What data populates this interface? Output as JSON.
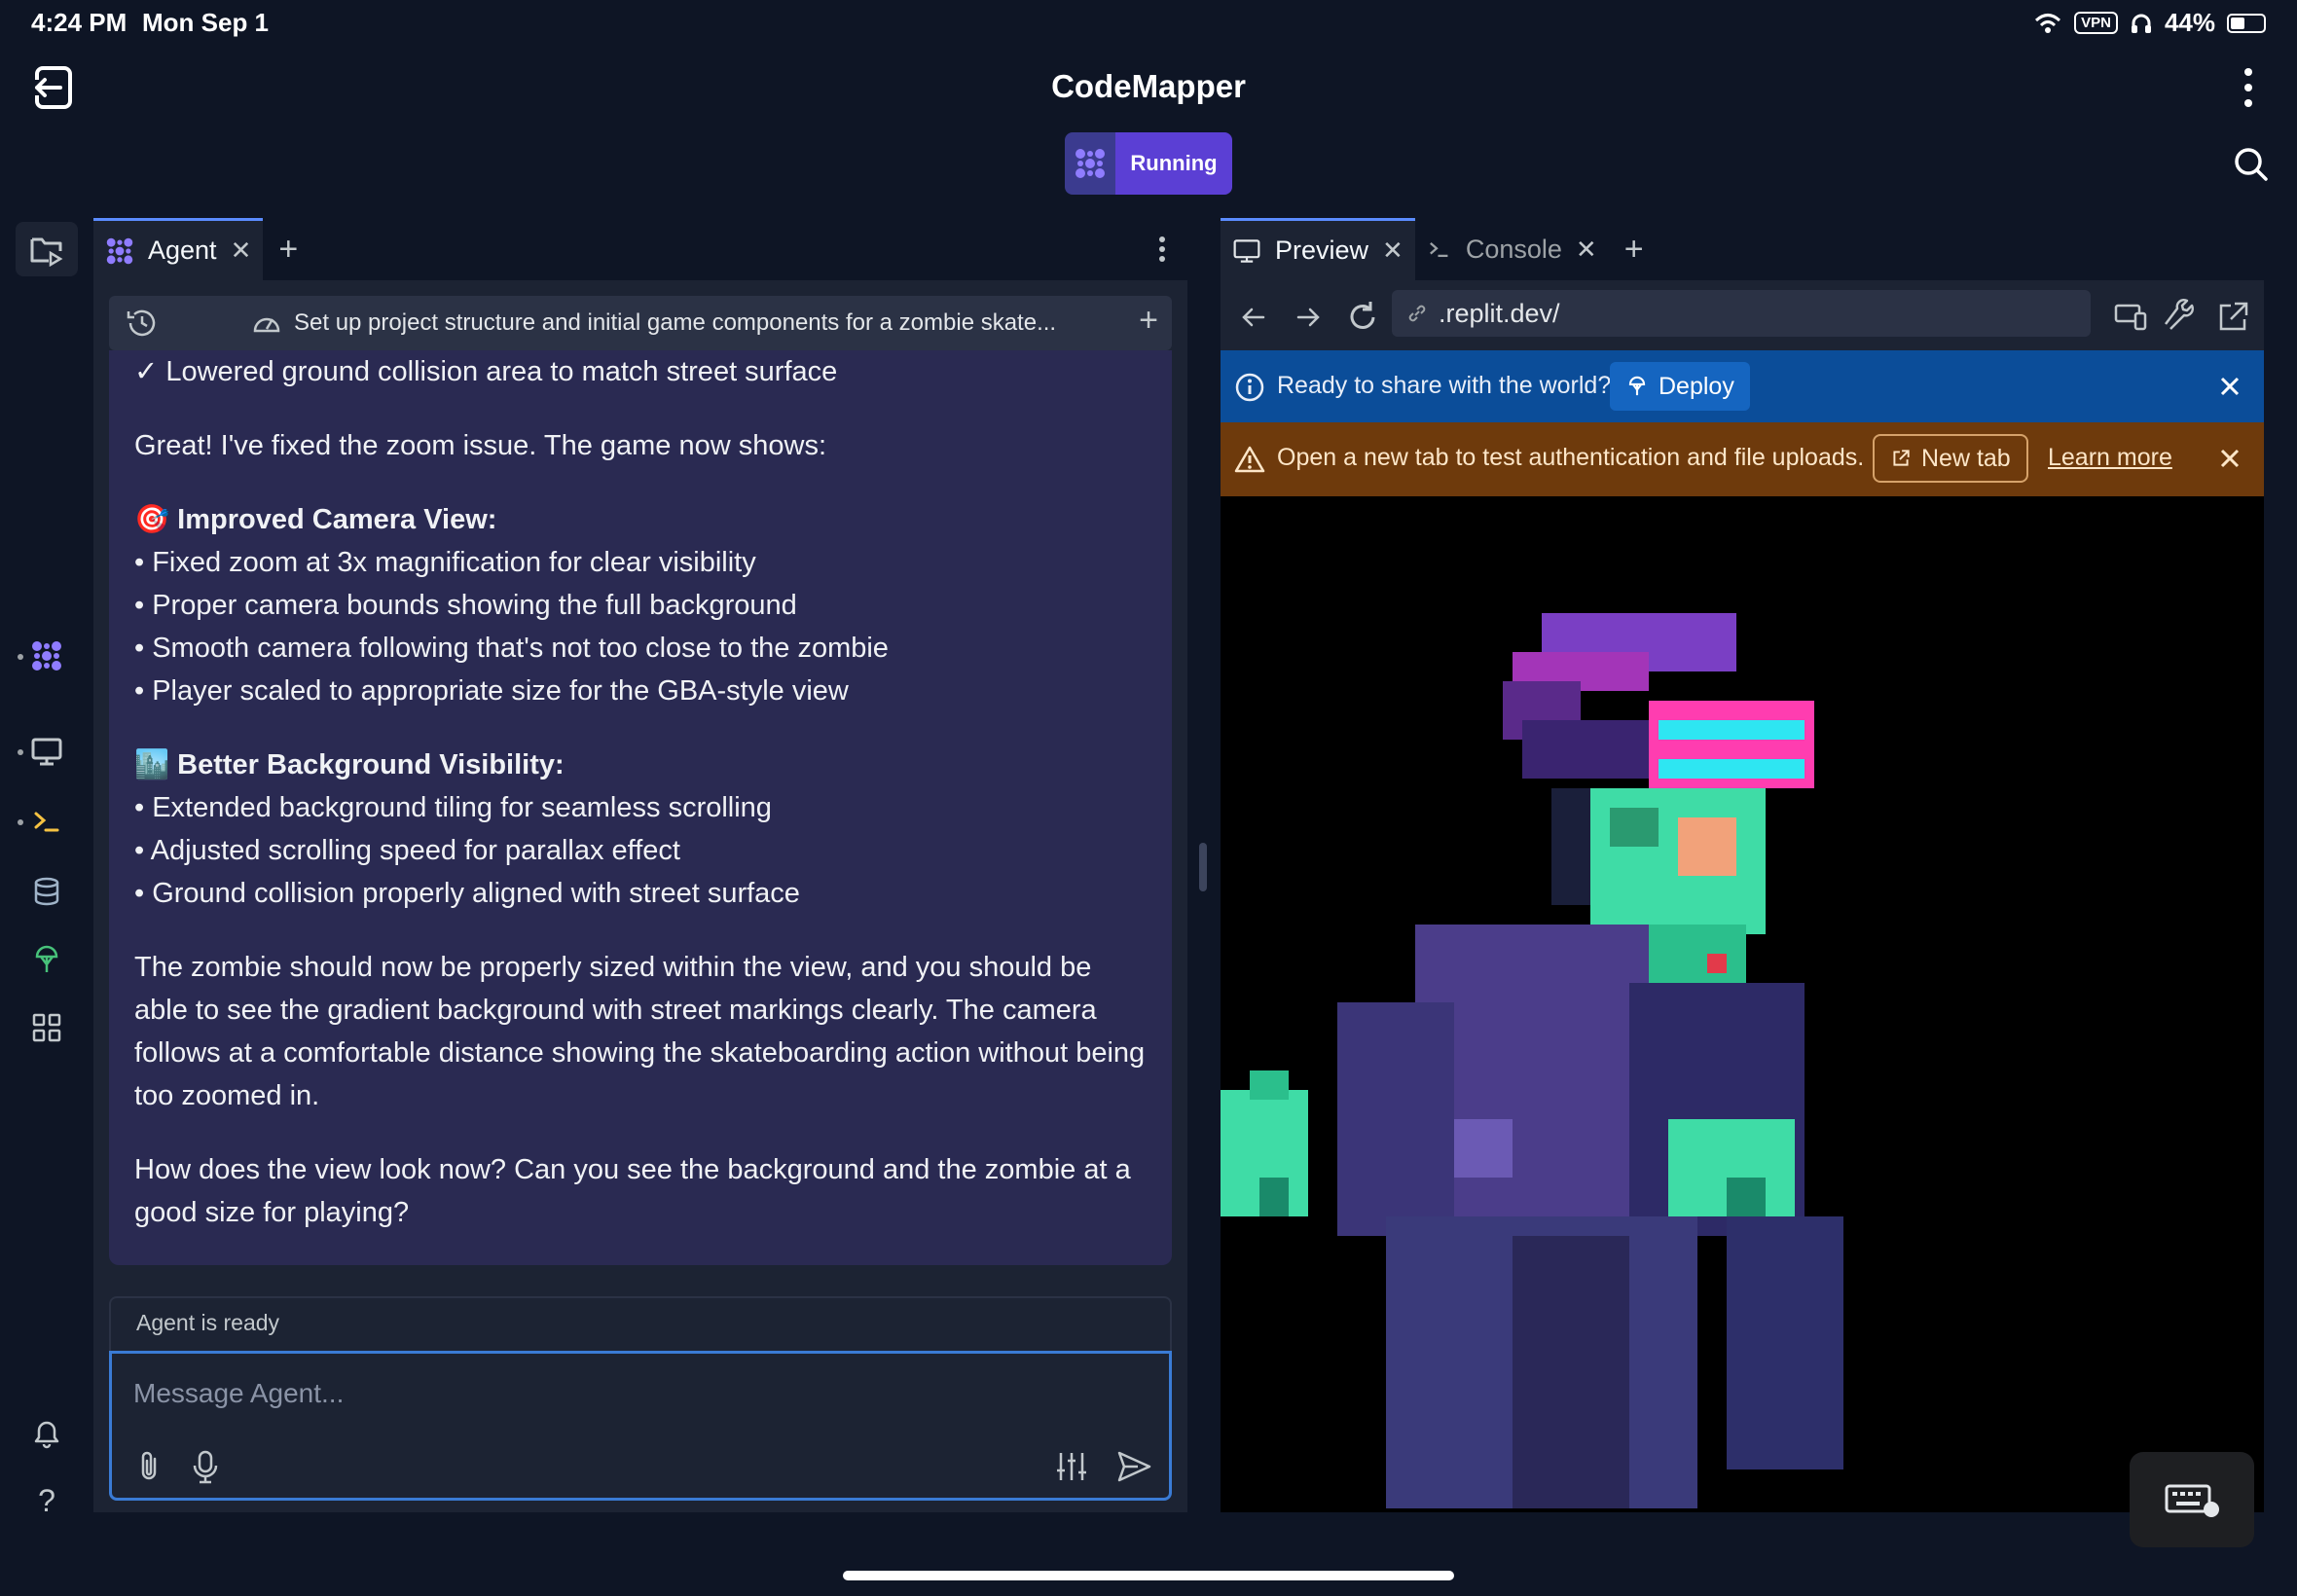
{
  "status": {
    "time": "4:24 PM",
    "date": "Mon Sep 1",
    "vpn": "VPN",
    "battery": "44%"
  },
  "header": {
    "title": "CodeMapper",
    "run_status": "Running"
  },
  "agent_panel": {
    "tab_label": "Agent",
    "task_title": "Set up project structure and initial game components for a zombie skate...",
    "messages": {
      "l1": "✓ Lowered ground collision area to match street surface",
      "l2": "Great! I've fixed the zoom issue. The game now shows:",
      "h1": "Improved Camera View:",
      "b1": "• Fixed zoom at 3x magnification for clear visibility",
      "b2": "• Proper camera bounds showing the full background",
      "b3": "• Smooth camera following that's not too close to the zombie",
      "b4": "• Player scaled to appropriate size for the GBA-style view",
      "h2": "Better Background Visibility:",
      "b5": "• Extended background tiling for seamless scrolling",
      "b6": "• Adjusted scrolling speed for parallax effect",
      "b7": "• Ground collision properly aligned with street surface",
      "p1": "The zombie should now be properly sized within the view, and you should be able to see the gradient background with street markings clearly. The camera follows at a comfortable distance showing the skateboarding action without being too zoomed in.",
      "p2": "How does the view look now? Can you see the background and the zombie at a good size for playing?"
    },
    "status_text": "Agent is ready",
    "input_placeholder": "Message Agent..."
  },
  "preview_panel": {
    "tab_preview": "Preview",
    "tab_console": "Console",
    "url": ".replit.dev/",
    "banner_ready": "Ready to share with the world?",
    "deploy_label": "Deploy",
    "banner_warning": "Open a new tab to test authentication and file uploads.",
    "new_tab_label": "New tab",
    "learn_more": "Learn more"
  },
  "colors": {
    "accent": "#5b3fd4",
    "chat_bg": "#2a2a52",
    "blue_banner": "#0b4d99",
    "orange_banner": "#6e3a0c"
  }
}
